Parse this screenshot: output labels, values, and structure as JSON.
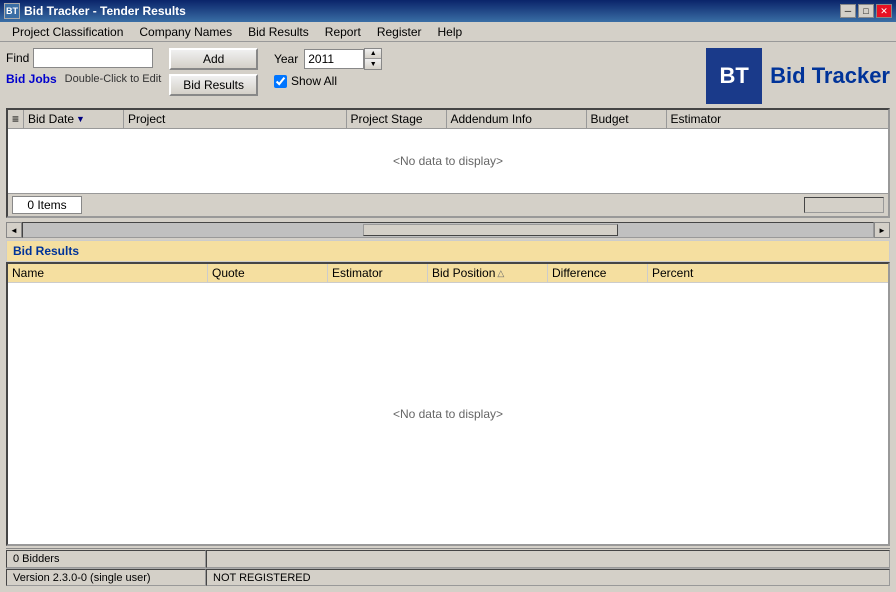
{
  "titlebar": {
    "icon": "BT",
    "title": "Bid Tracker - Tender Results",
    "min_btn": "─",
    "max_btn": "□",
    "close_btn": "✕"
  },
  "menubar": {
    "items": [
      {
        "label": "Project Classification"
      },
      {
        "label": "Company Names"
      },
      {
        "label": "Bid Results"
      },
      {
        "label": "Report"
      },
      {
        "label": "Register"
      },
      {
        "label": "Help"
      }
    ]
  },
  "toolbar": {
    "find_label": "Find",
    "find_value": "",
    "add_button": "Add",
    "bid_results_button": "Bid Results",
    "bid_jobs_label": "Bid Jobs",
    "double_click_label": "Double-Click to Edit",
    "year_label": "Year",
    "year_value": "2011",
    "show_all_label": "Show All",
    "show_all_checked": true
  },
  "logo": {
    "icon_text": "BT",
    "title": "Bid Tracker"
  },
  "main_table": {
    "columns": [
      {
        "label": "Bid Date"
      },
      {
        "label": "Project"
      },
      {
        "label": "Project Stage"
      },
      {
        "label": "Addendum Info"
      },
      {
        "label": "Budget"
      },
      {
        "label": "Estimator"
      }
    ],
    "no_data_text": "<No data to display>",
    "items_count": "0 Items"
  },
  "bid_results": {
    "header_label": "Bid Results",
    "columns": [
      {
        "label": "Name"
      },
      {
        "label": "Quote"
      },
      {
        "label": "Estimator"
      },
      {
        "label": "Bid Position"
      },
      {
        "label": "Difference"
      },
      {
        "label": "Percent"
      }
    ],
    "no_data_text": "<No data to display>"
  },
  "statusbar": {
    "bidders_text": "0 Bidders",
    "reg_text": ""
  },
  "versionbar": {
    "version_text": "Version 2.3.0-0 (single user)",
    "not_registered": "NOT REGISTERED"
  }
}
